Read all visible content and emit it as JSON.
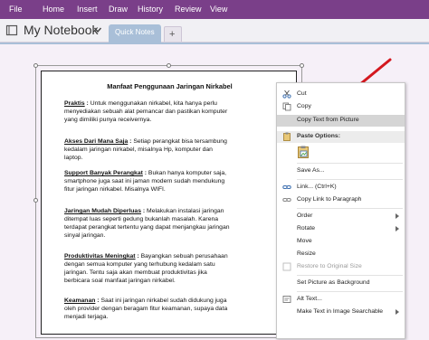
{
  "ribbon": {
    "tabs": [
      "File",
      "Home",
      "Insert",
      "Draw",
      "History",
      "Review",
      "View"
    ],
    "color": "#7a3f89"
  },
  "notebook": {
    "title": "My Notebook",
    "icon": "notebook-icon",
    "section_tab": "Quick Notes",
    "add_tab": "+"
  },
  "picture": {
    "title": "Manfaat Penggunaan Jaringan Nirkabel",
    "paragraphs": [
      {
        "head": "Praktis",
        "sep": " : ",
        "lines": [
          "Untuk menggunakan nirkabel, kita hanya perlu",
          "menyediakan sebuah alat pemancar dan pastikan komputer",
          "yang dimiliki punya receivernya."
        ]
      },
      {
        "head": "Akses Dari Mana Saja",
        "sep": " : ",
        "lines": [
          "Setiap perangkat bisa tersambung",
          "kedalam jaringan nirkabel, misalnya Hp, komputer dan",
          "laptop."
        ]
      },
      {
        "head": "Support Banyak Perangkat",
        "sep": " : ",
        "lines": [
          "Bukan hanya komputer saja,",
          "smartphone juga saat ini jaman modern sudah mendukung",
          "fitur jaringan nirkabel. Misalnya WIFI."
        ]
      },
      {
        "head": "Jaringan Mudah Diperluas",
        "sep": " : ",
        "lines": [
          "Melakukan instalasi jaringan",
          "ditempat luas seperti gedung bukanlah masalah. Karena",
          "terdapat perangkat tertentu yang dapat menjangkau jaringan",
          "sinyal jaringan."
        ]
      },
      {
        "head": "Produktivitas Meningkat",
        "sep": " : ",
        "lines": [
          "Bayangkan sebuah perusahaan",
          "dengan semua komputer yang terhubung kedalam satu",
          "jaringan. Tentu saja akan membuat produktivitas jika",
          "berbicara soal manfaat jaringan nirkabel."
        ]
      },
      {
        "head": "Keamanan",
        "sep": " : ",
        "lines": [
          "Saat ini jaringan nirkabel sudah didukung juga",
          "oleh provider dengan beragam fitur keamanan, supaya data",
          "menjadi terjaga."
        ]
      }
    ]
  },
  "context_menu": {
    "cut": "Cut",
    "copy": "Copy",
    "copy_text_from_picture": "Copy Text from Picture",
    "paste_options": "Paste Options:",
    "save_as": "Save As...",
    "link": "Link...  (Ctrl+K)",
    "copy_link_to_paragraph": "Copy Link to Paragraph",
    "order": "Order",
    "rotate": "Rotate",
    "move": "Move",
    "resize": "Resize",
    "restore_original_size": "Restore to Original Size",
    "set_picture_as_background": "Set Picture as Background",
    "alt_text": "Alt Text...",
    "make_text_searchable": "Make Text in Image Searchable",
    "highlight_color": "#d5d5d5"
  },
  "annotation": {
    "arrow_color": "#d4181f"
  }
}
